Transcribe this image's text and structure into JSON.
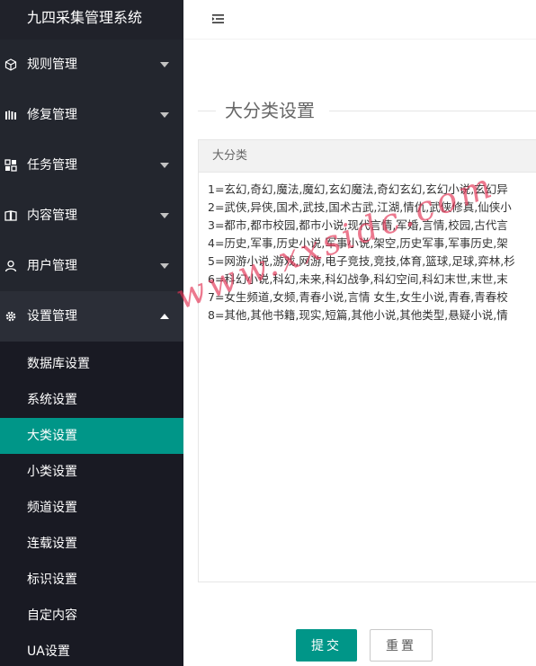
{
  "app": {
    "title": "九四采集管理系统"
  },
  "sidebar": {
    "items": [
      {
        "label": "规则管理",
        "icon": "cube-icon",
        "expanded": false
      },
      {
        "label": "修复管理",
        "icon": "wrench-icon",
        "expanded": false
      },
      {
        "label": "任务管理",
        "icon": "tasks-icon",
        "expanded": false
      },
      {
        "label": "内容管理",
        "icon": "book-icon",
        "expanded": false
      },
      {
        "label": "用户管理",
        "icon": "user-icon",
        "expanded": false
      },
      {
        "label": "设置管理",
        "icon": "gear-icon",
        "expanded": true
      }
    ],
    "submenu": [
      {
        "label": "数据库设置",
        "active": false
      },
      {
        "label": "系统设置",
        "active": false
      },
      {
        "label": "大类设置",
        "active": true
      },
      {
        "label": "小类设置",
        "active": false
      },
      {
        "label": "频道设置",
        "active": false
      },
      {
        "label": "连载设置",
        "active": false
      },
      {
        "label": "标识设置",
        "active": false
      },
      {
        "label": "自定内容",
        "active": false
      },
      {
        "label": "UA设置",
        "active": false
      }
    ]
  },
  "topbar": {
    "toggle_icon": "menu-fold-icon"
  },
  "main": {
    "section_title": "大分类设置",
    "card_header": "大分类",
    "textarea_value": "1=玄幻,奇幻,魔法,魔幻,玄幻魔法,奇幻玄幻,玄幻小说,玄幻异\n2=武侠,异侠,国术,武技,国术古武,江湖,情仇,武侠修真,仙侠小\n3=都市,都市校园,都市小说,现代言情,军婚,言情,校园,古代言\n4=历史,军事,历史小说,军事小说,架空,历史军事,军事历史,架\n5=网游小说,游戏,网游,电子竞技,竞技,体育,篮球,足球,弈林,杉\n6=科幻小说,科幻,未来,科幻战争,科幻空间,科幻末世,末世,末\n7=女生频道,女频,青春小说,言情 女生,女生小说,青春,青春校\n8=其他,其他书籍,现实,短篇,其他小说,其他类型,悬疑小说,情",
    "submit_label": "提交",
    "reset_label": "重置"
  },
  "watermark": "www.xxsidc.com",
  "colors": {
    "sidebar_bg": "#23262e",
    "submenu_bg": "#191a23",
    "accent": "#009688",
    "watermark": "#e23052"
  }
}
